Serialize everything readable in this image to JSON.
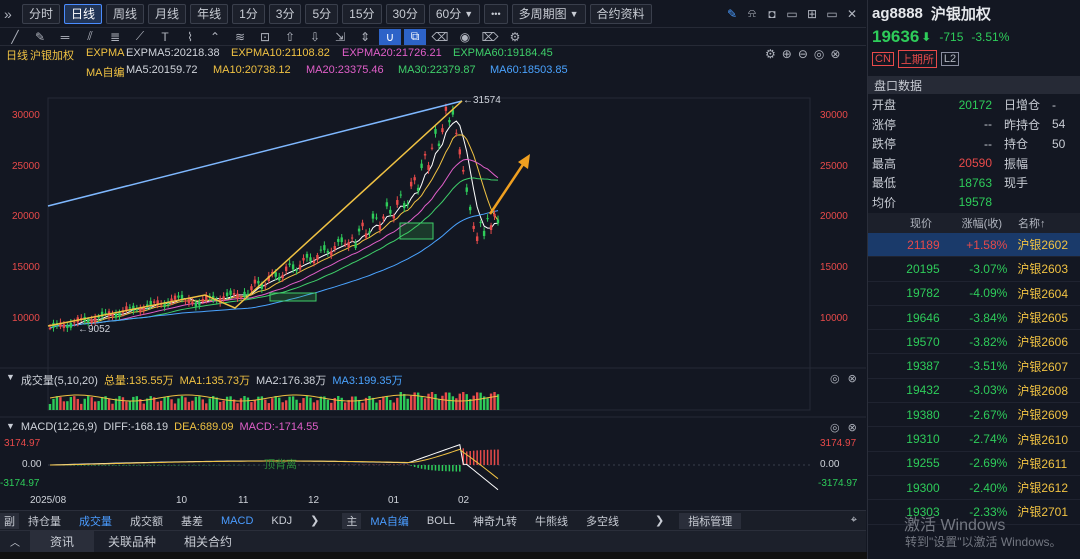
{
  "toolbar": {
    "expand_glyph": "»",
    "period_buttons": [
      {
        "label": "分时",
        "active": false
      },
      {
        "label": "日线",
        "active": true
      },
      {
        "label": "周线",
        "active": false
      },
      {
        "label": "月线",
        "active": false
      },
      {
        "label": "年线",
        "active": false
      },
      {
        "label": "1分",
        "active": false
      },
      {
        "label": "3分",
        "active": false
      },
      {
        "label": "5分",
        "active": false
      },
      {
        "label": "15分",
        "active": false
      },
      {
        "label": "30分",
        "active": false
      }
    ],
    "period_select": "60分",
    "more_glyph": "•••",
    "multi_period": "多周期图",
    "contract_info": "合约资料"
  },
  "chart_header": {
    "period": "日线",
    "name": "沪银加权",
    "expma_label": "EXPMA",
    "expma5": "EXPMA5:20218.38",
    "expma10": "EXPMA10:21108.82",
    "expma20": "EXPMA20:21726.21",
    "expma60": "EXPMA60:19184.45",
    "ma_label": "MA自编",
    "ma5": "MA5:20159.72",
    "ma10": "MA10:20738.12",
    "ma20": "MA20:23375.46",
    "ma30": "MA30:22379.87",
    "ma60": "MA60:18503.85"
  },
  "price_axis": [
    "30000",
    "25000",
    "20000",
    "15000",
    "10000"
  ],
  "annotations": {
    "high": "31574",
    "low": "9052"
  },
  "volume": {
    "label": "成交量(5,10,20)",
    "total": "总量:135.55万",
    "ma1": "MA1:135.73万",
    "ma2": "MA2:176.38万",
    "ma3": "MA3:199.35万"
  },
  "macd": {
    "label": "MACD(12,26,9)",
    "diff": "DIFF:-168.19",
    "dea": "DEA:689.09",
    "macd": "MACD:-1714.55",
    "axis_top": "3174.97",
    "axis_mid": "0.00",
    "axis_bot": "-3174.97",
    "note": "顶背离"
  },
  "x_axis": [
    "2025/08",
    "10",
    "11",
    "12",
    "01",
    "02"
  ],
  "sub_tabs_left": {
    "prefix": "副",
    "items": [
      {
        "label": "持仓量",
        "active": false
      },
      {
        "label": "成交量",
        "active": true
      },
      {
        "label": "成交额",
        "active": false
      },
      {
        "label": "基差",
        "active": false
      },
      {
        "label": "MACD",
        "active": true
      },
      {
        "label": "KDJ",
        "active": false
      }
    ]
  },
  "sub_tabs_main": {
    "prefix": "主",
    "items": [
      {
        "label": "MA自编",
        "active": true
      },
      {
        "label": "BOLL",
        "active": false
      },
      {
        "label": "神奇九转",
        "active": false
      },
      {
        "label": "牛熊线",
        "active": false
      },
      {
        "label": "多空线",
        "active": false
      }
    ],
    "manage": "指标管理"
  },
  "bottom_tabs": [
    "资讯",
    "关联品种",
    "相关合约"
  ],
  "quote": {
    "symbol": "ag8888",
    "name": "沪银加权",
    "price": "19636",
    "change": "-715",
    "change_pct": "-3.51%",
    "tags": [
      "CN",
      "上期所",
      "L2"
    ],
    "section": "盘口数据",
    "rows": [
      {
        "k1": "开盘",
        "v1": "20172",
        "k2": "日增仓",
        "v2": "-"
      },
      {
        "k1": "涨停",
        "v1": "--",
        "k2": "昨持仓",
        "v2": "54"
      },
      {
        "k1": "跌停",
        "v1": "--",
        "k2": "持仓",
        "v2": "50"
      },
      {
        "k1": "最高",
        "v1": "20590",
        "k2": "振幅",
        "v2": ""
      },
      {
        "k1": "最低",
        "v1": "18763",
        "k2": "现手",
        "v2": ""
      },
      {
        "k1": "均价",
        "v1": "19578",
        "k2": "",
        "v2": ""
      }
    ],
    "list_headers": [
      "现价",
      "涨幅(收)",
      "名称↑"
    ],
    "list": [
      {
        "price": "21189",
        "pct": "+1.58%",
        "name": "沪银2602",
        "up": true
      },
      {
        "price": "20195",
        "pct": "-3.07%",
        "name": "沪银2603",
        "up": false
      },
      {
        "price": "19782",
        "pct": "-4.09%",
        "name": "沪银2604",
        "up": false
      },
      {
        "price": "19646",
        "pct": "-3.84%",
        "name": "沪银2605",
        "up": false
      },
      {
        "price": "19570",
        "pct": "-3.82%",
        "name": "沪银2606",
        "up": false
      },
      {
        "price": "19387",
        "pct": "-3.51%",
        "name": "沪银2607",
        "up": false
      },
      {
        "price": "19432",
        "pct": "-3.03%",
        "name": "沪银2608",
        "up": false
      },
      {
        "price": "19380",
        "pct": "-2.67%",
        "name": "沪银2609",
        "up": false
      },
      {
        "price": "19310",
        "pct": "-2.74%",
        "name": "沪银2610",
        "up": false
      },
      {
        "price": "19255",
        "pct": "-2.69%",
        "name": "沪银2611",
        "up": false
      },
      {
        "price": "19300",
        "pct": "-2.40%",
        "name": "沪银2612",
        "up": false
      },
      {
        "price": "19303",
        "pct": "-2.33%",
        "name": "沪银2701",
        "up": false
      }
    ]
  },
  "watermark": {
    "line1": "激活 Windows",
    "line2": "转到\"设置\"以激活 Windows。"
  },
  "colors": {
    "up": "#e84a4a",
    "down": "#2ecc5a",
    "accent": "#4a8cff",
    "yellow": "#f0c243",
    "background": "#131722"
  }
}
